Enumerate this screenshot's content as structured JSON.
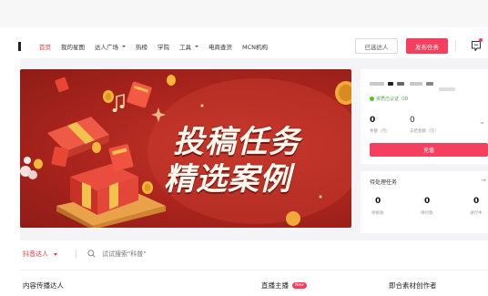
{
  "nav": {
    "items": [
      {
        "label": "首页",
        "active": true,
        "dropdown": false
      },
      {
        "label": "我的星图",
        "active": false,
        "dropdown": false
      },
      {
        "label": "达人广场",
        "active": false,
        "dropdown": true
      },
      {
        "label": "热榜",
        "active": false,
        "dropdown": false
      },
      {
        "label": "学院",
        "active": false,
        "dropdown": false
      },
      {
        "label": "工具",
        "active": false,
        "dropdown": true
      },
      {
        "label": "电商查货",
        "active": false,
        "dropdown": false
      },
      {
        "label": "MCN机构",
        "active": false,
        "dropdown": false
      }
    ],
    "selected_creators_label": "已选达人",
    "publish_task_label": "发布任务",
    "message_icon": "message-icon"
  },
  "banner": {
    "title_line1": "投稿任务",
    "title_line2": "精选案例"
  },
  "account": {
    "verified_text": "资质已认证（ID",
    "balance": {
      "value": "0",
      "label": "余额（元）"
    },
    "frozen": {
      "value": "0",
      "label": "冻结金额（元）"
    },
    "recharge_label": "充值"
  },
  "pending_tasks": {
    "title": "待处理任务",
    "items": [
      {
        "value": "0",
        "label": "待接收"
      },
      {
        "value": "0",
        "label": "待付款"
      },
      {
        "value": "0",
        "label": "进行中"
      }
    ]
  },
  "search": {
    "platform_label": "抖音达人",
    "placeholder": "试试搜索\"科普\""
  },
  "categories": {
    "content_creators": "内容传播达人",
    "live_hosts": "直播主播",
    "new_badge": "New",
    "material_creators": "即合素材创作者"
  },
  "colors": {
    "accent": "#f43f5e",
    "active_nav": "#f1363c",
    "banner_red": "#a9241d",
    "verified_green": "#52c41a"
  }
}
